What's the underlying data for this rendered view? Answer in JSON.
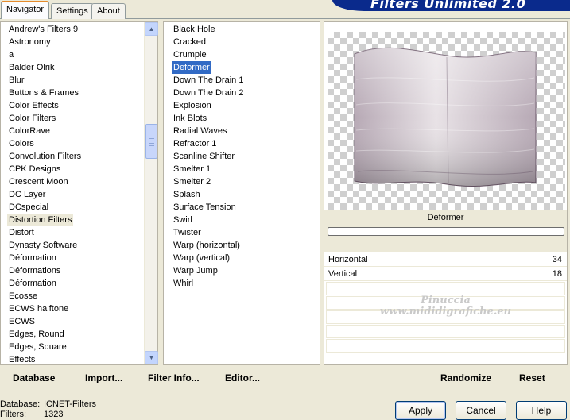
{
  "tabs": [
    {
      "label": "Navigator",
      "active": true
    },
    {
      "label": "Settings",
      "active": false
    },
    {
      "label": "About",
      "active": false
    }
  ],
  "banner_title": "Filters Unlimited 2.0",
  "categories": [
    "Andrew's Filters 9",
    "Astronomy",
    "a",
    "Balder Olrik",
    "Blur",
    "Buttons & Frames",
    "Color Effects",
    "Color Filters",
    "ColorRave",
    "Colors",
    "Convolution Filters",
    "CPK Designs",
    "Crescent Moon",
    "DC Layer",
    "DCspecial",
    "Distortion Filters",
    "Distort",
    "Dynasty Software",
    "Déformation",
    "Déformations",
    "Déformation",
    "Ecosse",
    "ECWS halftone",
    "ECWS",
    "Edges, Round",
    "Edges, Square",
    "Effects"
  ],
  "selected_category": "Distortion Filters",
  "filters": [
    "Black Hole",
    "Cracked",
    "Crumple",
    "Deformer",
    "Down The Drain 1",
    "Down The Drain 2",
    "Explosion",
    "Ink Blots",
    "Radial Waves",
    "Refractor 1",
    "Scanline Shifter",
    "Smelter 1",
    "Smelter 2",
    "Splash",
    "Surface Tension",
    "Swirl",
    "Twister",
    "Warp (horizontal)",
    "Warp (vertical)",
    "Warp Jump",
    "Whirl"
  ],
  "selected_filter": "Deformer",
  "preview": {
    "filter_name": "Deformer",
    "progress": 0,
    "colors": {
      "light": "#e8e2e6",
      "mid": "#b7a9b5",
      "dark": "#6e5a6c"
    }
  },
  "params": [
    {
      "label": "Horizontal",
      "value": "34"
    },
    {
      "label": "Vertical",
      "value": "18"
    }
  ],
  "watermark": {
    "line1": "Pinuccia",
    "line2": "www.mididigrafiche.eu"
  },
  "toolbar": {
    "database": "Database",
    "import": "Import...",
    "filter_info": "Filter Info...",
    "editor": "Editor...",
    "randomize": "Randomize",
    "reset": "Reset"
  },
  "status": {
    "database_label": "Database:",
    "database_value": "ICNET-Filters",
    "filters_label": "Filters:",
    "filters_value": "1323"
  },
  "buttons": {
    "apply": "Apply",
    "cancel": "Cancel",
    "help": "Help"
  },
  "icons": {
    "up": "scroll-up-arrow-icon",
    "down": "scroll-down-arrow-icon"
  }
}
